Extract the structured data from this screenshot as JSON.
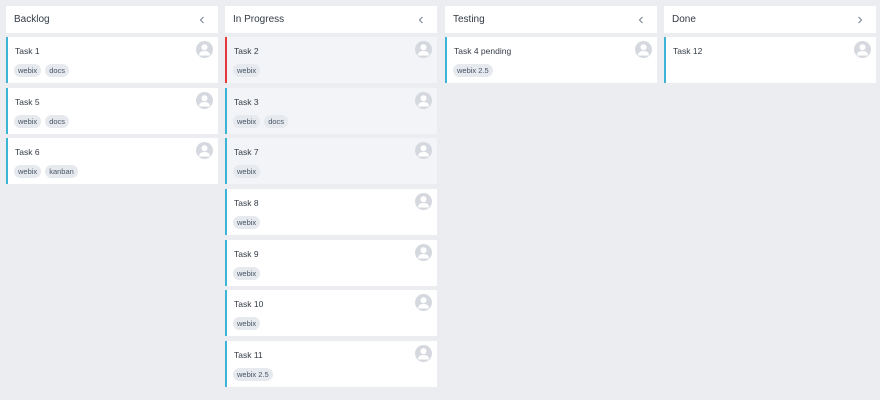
{
  "columns": [
    {
      "title": "Backlog",
      "toggle_icon": "chevron-left-icon",
      "cards": [
        {
          "text": "Task 1",
          "tags": [
            "webix",
            "docs"
          ],
          "shaded": false,
          "accent": "#3db4d6"
        },
        {
          "text": "Task 5",
          "tags": [
            "webix",
            "docs"
          ],
          "shaded": false,
          "accent": "#3db4d6"
        },
        {
          "text": "Task 6",
          "tags": [
            "webix",
            "kanban"
          ],
          "shaded": false,
          "accent": "#3db4d6"
        }
      ]
    },
    {
      "title": "In Progress",
      "toggle_icon": "chevron-left-icon",
      "cards": [
        {
          "text": "Task 2",
          "tags": [
            "webix"
          ],
          "shaded": true,
          "accent": "#e33b3b"
        },
        {
          "text": "Task 3",
          "tags": [
            "webix",
            "docs"
          ],
          "shaded": true,
          "accent": "#3db4d6"
        },
        {
          "text": "Task 7",
          "tags": [
            "webix"
          ],
          "shaded": true,
          "accent": "#3db4d6"
        },
        {
          "text": "Task 8",
          "tags": [
            "webix"
          ],
          "shaded": false,
          "accent": "#3db4d6"
        },
        {
          "text": "Task 9",
          "tags": [
            "webix"
          ],
          "shaded": false,
          "accent": "#3db4d6"
        },
        {
          "text": "Task 10",
          "tags": [
            "webix"
          ],
          "shaded": false,
          "accent": "#3db4d6"
        },
        {
          "text": "Task 11",
          "tags": [
            "webix 2.5"
          ],
          "shaded": false,
          "accent": "#3db4d6"
        }
      ]
    },
    {
      "title": "Testing",
      "toggle_icon": "chevron-left-icon",
      "cards": [
        {
          "text": "Task 4 pending",
          "tags": [
            "webix 2.5"
          ],
          "shaded": false,
          "accent": "#3db4d6"
        }
      ]
    },
    {
      "title": "Done",
      "toggle_icon": "chevron-right-icon",
      "cards": [
        {
          "text": "Task 12",
          "tags": [],
          "shaded": false,
          "accent": "#3db4d6"
        }
      ]
    }
  ],
  "colors": {
    "background": "#ebedf0",
    "card_accent": "#3db4d6",
    "card_accent_alert": "#e33b3b",
    "avatar": "#d5d9df",
    "tag_bg": "#e6e9ed"
  }
}
